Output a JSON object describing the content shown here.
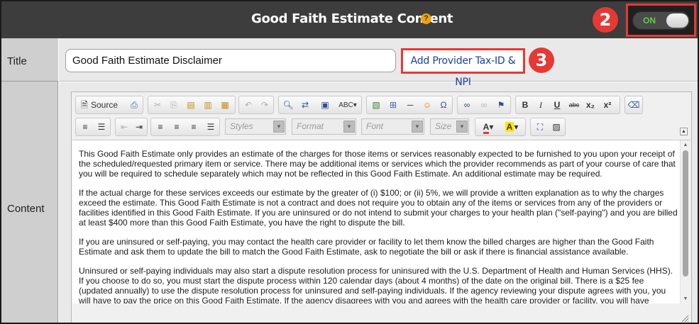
{
  "header": {
    "title": "Good Faith Estimate Content",
    "help_icon": "question-circle-icon",
    "toggle_label": "ON",
    "toggle_state": "on",
    "callout_toggle": "2",
    "accent_color": "#e53935",
    "toggle_on_color": "#5bd13a"
  },
  "rows": {
    "title_label": "Title",
    "content_label": "Content"
  },
  "title_field": {
    "value": "Good Faith Estimate Disclaimer"
  },
  "add_provider": {
    "label": "Add Provider Tax-ID & NPI",
    "callout": "3"
  },
  "editor": {
    "toolbar": {
      "source_label": "Source",
      "styles": "Styles",
      "format": "Format",
      "font": "Font",
      "size": "Size",
      "icons": [
        "source-icon",
        "print-icon",
        "cut-icon",
        "copy-icon",
        "paste-icon",
        "paste-text-icon",
        "paste-word-icon",
        "undo-icon",
        "redo-icon",
        "find-icon",
        "replace-icon",
        "select-all-icon",
        "spellcheck-icon",
        "image-icon",
        "table-icon",
        "horizontal-line-icon",
        "smiley-icon",
        "special-char-icon",
        "link-icon",
        "unlink-icon",
        "anchor-icon",
        "bold-icon",
        "italic-icon",
        "underline-icon",
        "strikethrough-icon",
        "subscript-icon",
        "superscript-icon",
        "remove-format-icon",
        "numbered-list-icon",
        "bulleted-list-icon",
        "outdent-icon",
        "indent-icon",
        "align-left-icon",
        "align-center-icon",
        "align-right-icon",
        "justify-icon",
        "text-color-icon",
        "background-color-icon",
        "maximize-icon",
        "show-blocks-icon"
      ]
    },
    "paragraphs": [
      "This Good Faith Estimate only provides an estimate of the charges for those items or services reasonably expected to be furnished to you upon your receipt of the scheduled/requested primary item or service. There may be additional items or services which the provider recommends as part of your course of care that you will be required to schedule separately which may not be reflected in this Good Faith Estimate. An additional estimate may be required.",
      "If the actual charge for these services exceeds our estimate by the greater of (i) $100; or (ii) 5%, we will provide a written explanation as to why the charges exceed the estimate. This Good Faith Estimate is not a contract and does not require you to obtain any of the items or services from any of the providers or facilities identified in this Good Faith Estimate. If you are uninsured or do not intend to submit your charges to your health plan (\"self-paying\") and you are billed at least $400 more than this Good Faith Estimate, you have the right to dispute the bill.",
      "If you are uninsured or self-paying, you may contact the health care provider or facility to let them know the billed charges are higher than the Good Faith Estimate and ask them to update the bill to match the Good Faith Estimate, ask to negotiate the bill or ask if there is financial assistance available.",
      "Uninsured or self-paying individuals may also start a dispute resolution process for uninsured with the U.S. Department of Health and Human Services (HHS). If you choose to do so, you must start the dispute process within 120 calendar days (about 4 months) of the date on the original bill. There is a $25 fee (updated annually) to use the dispute resolution process for uninsured and self-paying individuals. If the agency reviewing your dispute agrees with you, you will have to pay the price on this Good Faith Estimate. If the agency disagrees with you and agrees with the health care provider or facility, you will have"
    ]
  }
}
